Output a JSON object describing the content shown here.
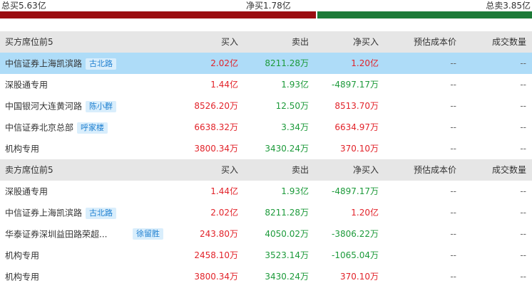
{
  "summary": {
    "buy_total": "总买5.63亿",
    "net": "净买1.78亿",
    "sell_total": "总卖3.85亿",
    "buy_color": "#9b0c10",
    "sell_color": "#1c7a37"
  },
  "columns": {
    "buy": "买入",
    "sell": "卖出",
    "net": "净买入",
    "cost": "预估成本价",
    "vol": "成交数量"
  },
  "buyers": {
    "title": "买方席位前5",
    "rows": [
      {
        "name": "中信证券上海凯滨路",
        "tag": "古北路",
        "buy": "2.02亿",
        "sell": "8211.28万",
        "net": "1.20亿",
        "cost": "--",
        "vol": "--"
      },
      {
        "name": "深股通专用",
        "tag": "",
        "buy": "1.44亿",
        "sell": "1.93亿",
        "net": "-4897.17万",
        "cost": "--",
        "vol": "--"
      },
      {
        "name": "中国银河大连黄河路",
        "tag": "陈小群",
        "buy": "8526.20万",
        "sell": "12.50万",
        "net": "8513.70万",
        "cost": "--",
        "vol": "--"
      },
      {
        "name": "中信证券北京总部",
        "tag": "呼家楼",
        "buy": "6638.32万",
        "sell": "3.34万",
        "net": "6634.97万",
        "cost": "--",
        "vol": "--"
      },
      {
        "name": "机构专用",
        "tag": "",
        "buy": "3800.34万",
        "sell": "3430.24万",
        "net": "370.10万",
        "cost": "--",
        "vol": "--"
      }
    ]
  },
  "sellers": {
    "title": "卖方席位前5",
    "rows": [
      {
        "name": "深股通专用",
        "tag": "",
        "buy": "1.44亿",
        "sell": "1.93亿",
        "net": "-4897.17万",
        "cost": "--",
        "vol": "--"
      },
      {
        "name": "中信证券上海凯滨路",
        "tag": "古北路",
        "buy": "2.02亿",
        "sell": "8211.28万",
        "net": "1.20亿",
        "cost": "--",
        "vol": "--"
      },
      {
        "name": "华泰证券深圳益田路荣超...",
        "tag": "徐留胜",
        "buy": "243.80万",
        "sell": "4050.02万",
        "net": "-3806.22万",
        "cost": "--",
        "vol": "--"
      },
      {
        "name": "机构专用",
        "tag": "",
        "buy": "2458.10万",
        "sell": "3523.14万",
        "net": "-1065.04万",
        "cost": "--",
        "vol": "--"
      },
      {
        "name": "机构专用",
        "tag": "",
        "buy": "3800.34万",
        "sell": "3430.24万",
        "net": "370.10万",
        "cost": "--",
        "vol": "--"
      }
    ]
  }
}
